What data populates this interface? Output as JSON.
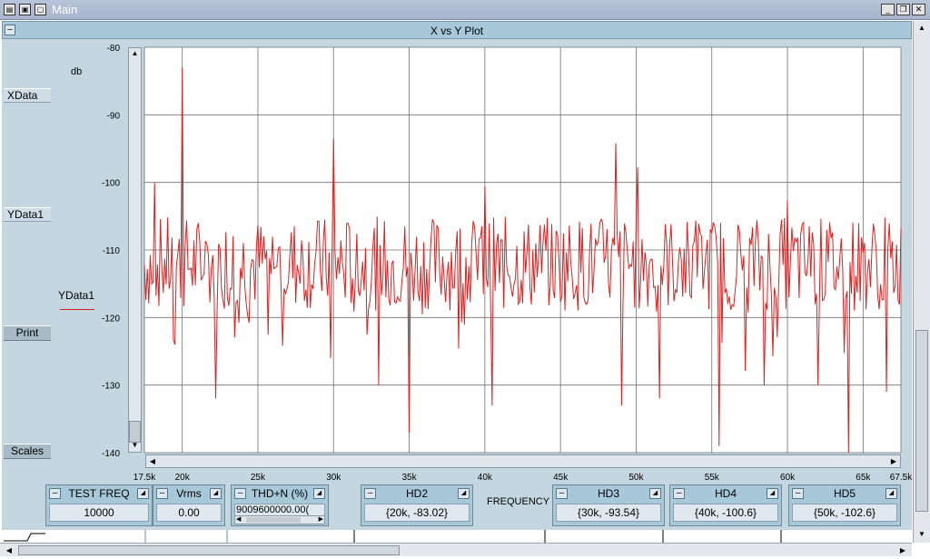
{
  "window": {
    "title": "Main",
    "controls": [
      "minimize-icon",
      "restore-icon",
      "close-icon"
    ]
  },
  "panel": {
    "title": "X vs Y Plot"
  },
  "left_panel": {
    "xdata_label": "XData",
    "ydata_label": "YData1",
    "print_label": "Print",
    "scales_label": "Scales"
  },
  "legend": {
    "series_label": "YData1",
    "series_color": "#dd2020"
  },
  "chart_data": {
    "type": "line",
    "ylabel": "db",
    "xlabel": "FREQUENCY",
    "xlim": [
      17500,
      67500
    ],
    "ylim": [
      -140,
      -80
    ],
    "x_ticks": [
      "17.5k",
      "20k",
      "25k",
      "30k",
      "35k",
      "40k",
      "45k",
      "50k",
      "55k",
      "60k",
      "65k",
      "67.5k"
    ],
    "x_tick_values": [
      17500,
      20000,
      25000,
      30000,
      35000,
      40000,
      45000,
      50000,
      55000,
      60000,
      65000,
      67500
    ],
    "y_ticks": [
      "-80",
      "-90",
      "-100",
      "-110",
      "-120",
      "-130",
      "-140"
    ],
    "y_tick_values": [
      -80,
      -90,
      -100,
      -110,
      -120,
      -130,
      -140
    ],
    "grid": true,
    "series": [
      {
        "name": "YData1",
        "color": "#dd2020",
        "noise_floor": -112,
        "peaks": [
          {
            "x": 20000,
            "y": -83.02
          },
          {
            "x": 30000,
            "y": -93.54
          },
          {
            "x": 40000,
            "y": -100.6
          },
          {
            "x": 48700,
            "y": -94.2
          },
          {
            "x": 50100,
            "y": -97.8
          },
          {
            "x": 18200,
            "y": -100
          },
          {
            "x": 60000,
            "y": -102.6
          }
        ],
        "dips": [
          {
            "x": 19500,
            "y": -124
          },
          {
            "x": 22200,
            "y": -132
          },
          {
            "x": 29800,
            "y": -126
          },
          {
            "x": 33000,
            "y": -130
          },
          {
            "x": 35000,
            "y": -137
          },
          {
            "x": 40500,
            "y": -133
          },
          {
            "x": 49000,
            "y": -133
          },
          {
            "x": 51500,
            "y": -132
          },
          {
            "x": 55500,
            "y": -139
          },
          {
            "x": 58500,
            "y": -130
          },
          {
            "x": 62000,
            "y": -130
          },
          {
            "x": 64000,
            "y": -140
          },
          {
            "x": 66500,
            "y": -131
          }
        ]
      }
    ]
  },
  "indicators": {
    "test_freq": {
      "title": "TEST FREQ",
      "value": "10000"
    },
    "vrms": {
      "title": "Vrms",
      "value": "0.00"
    },
    "thdn": {
      "title": "THD+N (%)",
      "value": "9009600000.00("
    },
    "hd2": {
      "title": "HD2",
      "value": "{20k, -83.02}"
    },
    "hd3": {
      "title": "HD3",
      "value": "{30k, -93.54}"
    },
    "hd4": {
      "title": "HD4",
      "value": "{40k, -100.6}"
    },
    "hd5": {
      "title": "HD5",
      "value": "{50k, -102.6}"
    }
  }
}
